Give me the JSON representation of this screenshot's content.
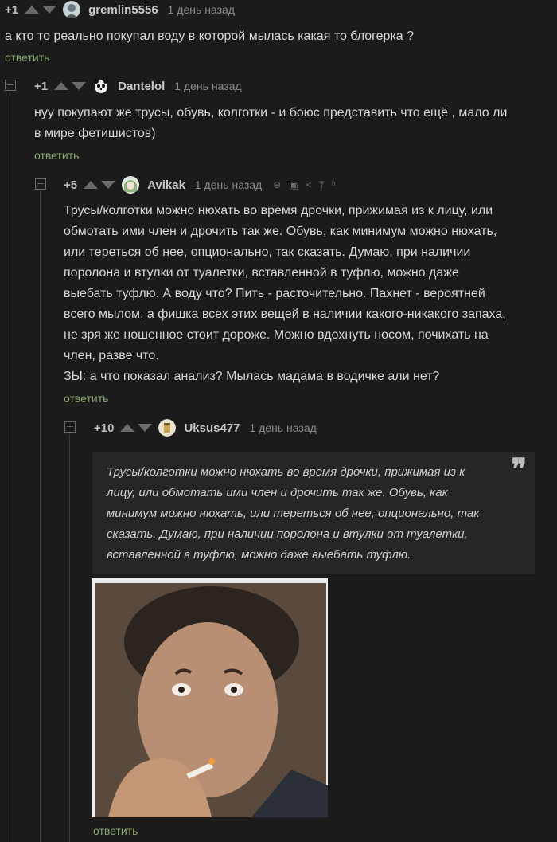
{
  "comments": [
    {
      "rating": "+1",
      "username": "gremlin5556",
      "time": "1 день назад",
      "text": "а кто то реально покупал воду в которой мылась какая то блогерка ?",
      "reply": "ответить",
      "avatar": "avatar-icon"
    },
    {
      "rating": "+1",
      "username": "Dantelol",
      "time": "1 день назад",
      "text_lines": [
        "нуу покупают же трусы, обувь, колготки - и боюс представить что ещё , мало ли",
        "в мире фетишистов)"
      ],
      "reply": "ответить",
      "avatar": "panda-avatar-icon"
    },
    {
      "rating": "+5",
      "username": "Avikak",
      "time": "1 день назад",
      "tools": [
        "link-icon",
        "save-icon",
        "share-icon",
        "up-to-parent-icon",
        "branch-icon"
      ],
      "text_lines": [
        "Трусы/колготки можно нюхать во время дрочки, прижимая из к лицу, или",
        "обмотать ими член и дрочить так же. Обувь, как минимум можно нюхать,",
        "или тереться об нее, опционально, так сказать. Думаю, при наличии",
        "поролона и втулки от туалетки, вставленной в туфлю, можно даже",
        "выебать туфлю. А воду что? Пить - расточительно. Пахнет - вероятней",
        "всего мылом, а фишка всех этих вещей в наличии какого-никакого запаха,",
        "не зря же ношенное стоит дороже. Можно вдохнуть носом, почихать на",
        "член, разве что.",
        "ЗЫ: а что показал анализ? Мылась мадама в водичке али нет?"
      ],
      "reply": "ответить",
      "avatar": "anime-avatar-icon"
    },
    {
      "rating": "+10",
      "username": "Uksus477",
      "time": "1 день назад",
      "quote_lines": [
        "Трусы/колготки можно нюхать во время дрочки, прижимая из к",
        "лицу, или обмотать ими член и дрочить так же. Обувь, как",
        "минимум можно нюхать, или тереться об нее, опционально, так",
        "сказать. Думаю, при наличии поролона и втулки от туалетки,",
        "вставленной в туфлю, можно даже выебать туфлю."
      ],
      "quote_mark": "❞",
      "image": "reaction-photo-man-smoking",
      "reply": "ответить",
      "avatar": "jar-avatar-icon"
    }
  ],
  "colors": {
    "background": "#1b1b1b",
    "reply_link": "#89a86c",
    "quote_bg": "#262626",
    "muted": "#8a8a8a"
  }
}
